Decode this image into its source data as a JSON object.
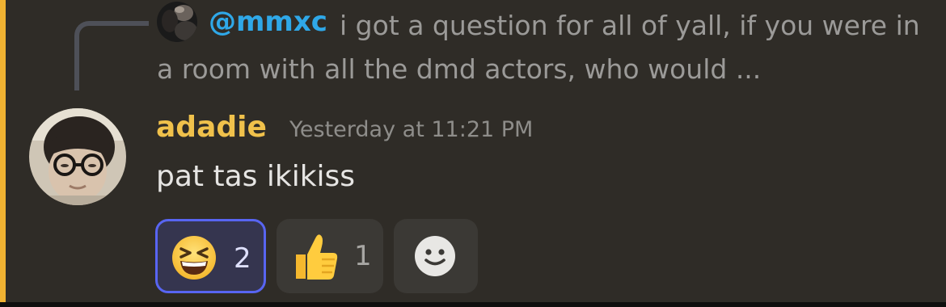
{
  "reply": {
    "username": "@mmxc",
    "text": "i got a question for all of yall, if you were in a room with all the dmd actors, who would ..."
  },
  "message": {
    "username": "adadie",
    "timestamp": "Yesterday at 11:21 PM",
    "content": "pat tas ikikiss"
  },
  "reactions": [
    {
      "emoji": "laughing-squinting-face",
      "count": "2",
      "selected": true
    },
    {
      "emoji": "thumbs-up",
      "count": "1",
      "selected": false
    }
  ],
  "add_reaction": {
    "icon": "smiley-add-reaction-icon"
  },
  "colors": {
    "background": "#2f2c27",
    "highlight_bar": "#f0b232",
    "mention": "#2fa8e8",
    "username": "#f0c14b",
    "selected_reaction_border": "#5865f2"
  }
}
